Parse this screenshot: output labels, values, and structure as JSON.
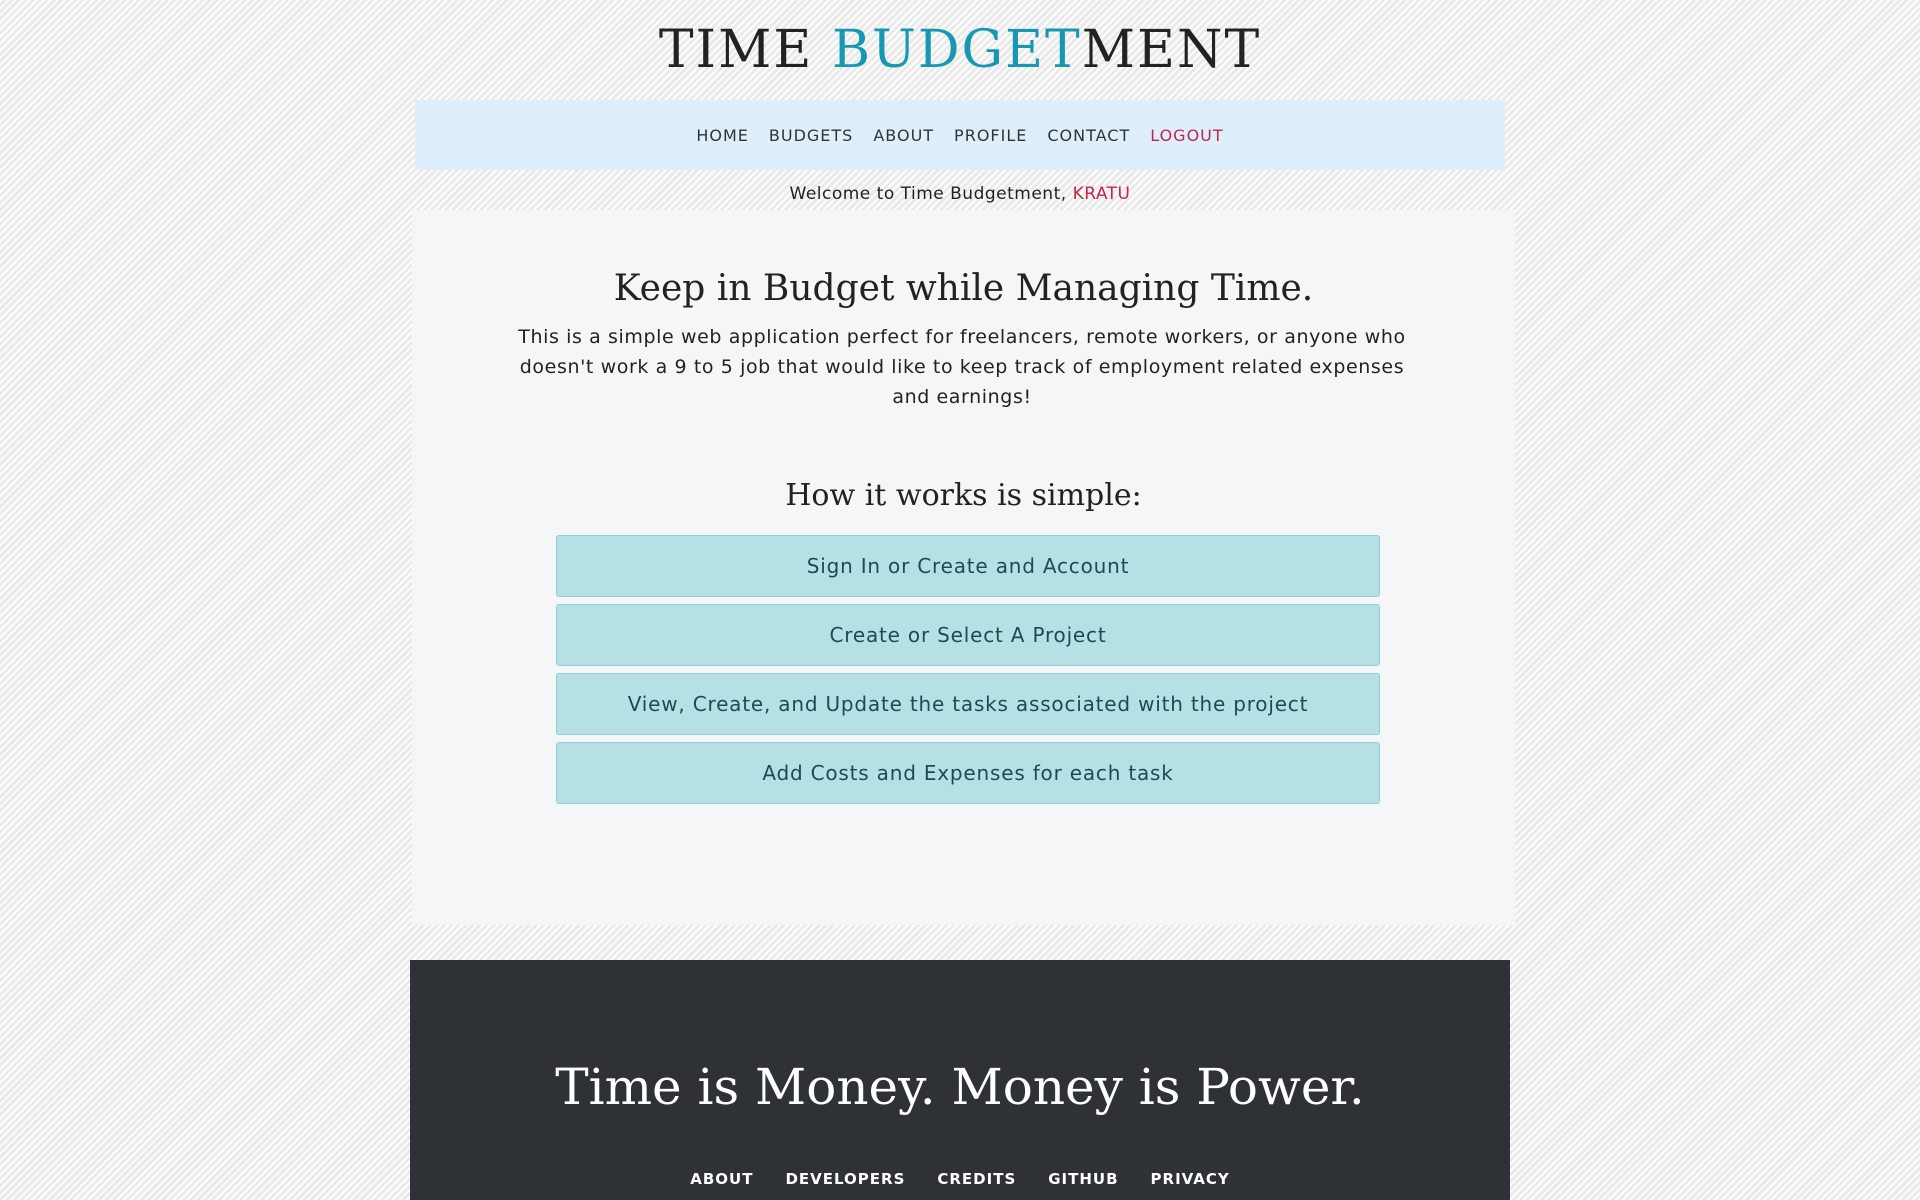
{
  "header": {
    "title_part1": "TIME ",
    "title_accent": "BUDGET",
    "title_part2": "MENT"
  },
  "nav": {
    "items": [
      "HOME",
      "BUDGETS",
      "ABOUT",
      "PROFILE",
      "CONTACT",
      "LOGOUT"
    ]
  },
  "welcome": {
    "text": "Welcome to Time Budgetment, ",
    "user": "KRATU"
  },
  "main": {
    "headline": "Keep in Budget while Managing Time.",
    "intro": "This is a simple web application perfect for freelancers, remote workers, or anyone who doesn't work a 9 to 5 job that would like to keep track of employment related expenses and earnings!",
    "how_title": "How it works is simple:",
    "steps": [
      "Sign In or Create and Account",
      "Create or Select A Project",
      "View, Create, and Update the tasks associated with the project",
      "Add Costs and Expenses for each task"
    ]
  },
  "footer": {
    "tagline": "Time is Money. Money is Power.",
    "links": [
      "ABOUT",
      "DEVELOPERS",
      "CREDITS",
      "GITHUB",
      "PRIVACY"
    ]
  },
  "colors": {
    "accent": "#1797b1",
    "logout": "#c0264a",
    "nav_bg": "#dfeefb",
    "step_bg": "#b5e0e6",
    "footer_bg": "#2e3236"
  }
}
